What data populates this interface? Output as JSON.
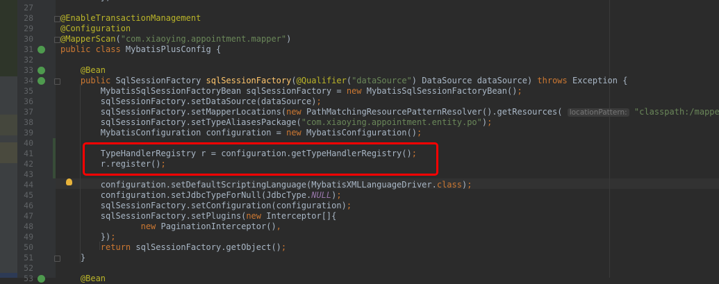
{
  "editor": {
    "lines": [
      {
        "n": "26",
        "tokens": [
          [
            "        };",
            ""
          ]
        ]
      },
      {
        "n": "27",
        "tokens": []
      },
      {
        "n": "28",
        "tokens": [
          [
            "@EnableTransactionManagement",
            "a"
          ]
        ]
      },
      {
        "n": "29",
        "tokens": [
          [
            "@Configuration",
            "a"
          ]
        ]
      },
      {
        "n": "30",
        "tokens": [
          [
            "@MapperScan",
            "a"
          ],
          [
            "(",
            ""
          ],
          [
            "\"com.xiaoying.appointment.mapper\"",
            "s"
          ],
          [
            ")",
            ""
          ]
        ]
      },
      {
        "n": "31",
        "tokens": [
          [
            "public class ",
            "k"
          ],
          [
            "MybatisPlusConfig {",
            ""
          ]
        ]
      },
      {
        "n": "32",
        "tokens": []
      },
      {
        "n": "33",
        "tokens": [
          [
            "    ",
            ""
          ],
          [
            "@Bean",
            "a"
          ]
        ]
      },
      {
        "n": "34",
        "tokens": [
          [
            "    ",
            ""
          ],
          [
            "public ",
            "k"
          ],
          [
            "SqlSessionFactory ",
            ""
          ],
          [
            "sqlSessionFactory",
            "m"
          ],
          [
            "(",
            ""
          ],
          [
            "@Qualifier",
            "a"
          ],
          [
            "(",
            ""
          ],
          [
            "\"dataSource\"",
            "s"
          ],
          [
            ") DataSource dataSource) ",
            ""
          ],
          [
            "throws ",
            "k"
          ],
          [
            "Exception {",
            ""
          ]
        ]
      },
      {
        "n": "35",
        "tokens": [
          [
            "        MybatisSqlSessionFactoryBean sqlSessionFactory = ",
            ""
          ],
          [
            "new ",
            "k"
          ],
          [
            "MybatisSqlSessionFactoryBean()",
            ""
          ],
          [
            ";",
            "p"
          ]
        ]
      },
      {
        "n": "36",
        "tokens": [
          [
            "        sqlSessionFactory.setDataSource(dataSource)",
            ""
          ],
          [
            ";",
            "p"
          ]
        ]
      },
      {
        "n": "37",
        "tokens": [
          [
            "        sqlSessionFactory.setMapperLocations(",
            ""
          ],
          [
            "new ",
            "k"
          ],
          [
            "PathMatchingResourcePatternResolver().getResources( ",
            ""
          ],
          [
            "locationPattern:",
            "hint"
          ],
          [
            " ",
            ""
          ],
          [
            "\"classpath:/mapper/*.x",
            "s"
          ]
        ]
      },
      {
        "n": "38",
        "tokens": [
          [
            "        sqlSessionFactory.setTypeAliasesPackage(",
            ""
          ],
          [
            "\"com.xiaoying.appointment.entity.po\"",
            "s"
          ],
          [
            ")",
            ""
          ],
          [
            ";",
            "p"
          ]
        ]
      },
      {
        "n": "39",
        "tokens": [
          [
            "        MybatisConfiguration configuration = ",
            ""
          ],
          [
            "new ",
            "k"
          ],
          [
            "MybatisConfiguration()",
            ""
          ],
          [
            ";",
            "p"
          ]
        ]
      },
      {
        "n": "40",
        "tokens": []
      },
      {
        "n": "41",
        "tokens": [
          [
            "        TypeHandlerRegistry r = configuration.getTypeHandlerRegistry()",
            ""
          ],
          [
            ";",
            "p"
          ]
        ]
      },
      {
        "n": "42",
        "tokens": [
          [
            "        r.register()",
            ""
          ],
          [
            ";",
            "p"
          ]
        ]
      },
      {
        "n": "43",
        "tokens": []
      },
      {
        "n": "44",
        "tokens": [
          [
            "        configuration.setDefaultScriptingLanguage(MybatisXMLLanguageDriver.",
            ""
          ],
          [
            "class",
            "k"
          ],
          [
            ")",
            ""
          ],
          [
            ";",
            "p"
          ]
        ]
      },
      {
        "n": "45",
        "tokens": [
          [
            "        configuration.setJdbcTypeForNull(JdbcType.",
            ""
          ],
          [
            "NULL",
            "c"
          ],
          [
            ")",
            ""
          ],
          [
            ";",
            "p"
          ]
        ]
      },
      {
        "n": "46",
        "tokens": [
          [
            "        sqlSessionFactory.setConfiguration(configuration)",
            ""
          ],
          [
            ";",
            "p"
          ]
        ]
      },
      {
        "n": "47",
        "tokens": [
          [
            "        sqlSessionFactory.setPlugins(",
            ""
          ],
          [
            "new ",
            "k"
          ],
          [
            "Interceptor[]{",
            ""
          ]
        ]
      },
      {
        "n": "48",
        "tokens": [
          [
            "                ",
            ""
          ],
          [
            "new ",
            "k"
          ],
          [
            "PaginationInterceptor()",
            ""
          ],
          [
            ",",
            "p"
          ]
        ]
      },
      {
        "n": "49",
        "tokens": [
          [
            "        })",
            ""
          ],
          [
            ";",
            "p"
          ]
        ]
      },
      {
        "n": "50",
        "tokens": [
          [
            "        ",
            ""
          ],
          [
            "return ",
            "k"
          ],
          [
            "sqlSessionFactory.getObject()",
            ""
          ],
          [
            ";",
            "p"
          ]
        ]
      },
      {
        "n": "51",
        "tokens": [
          [
            "    }",
            ""
          ]
        ]
      },
      {
        "n": "52",
        "tokens": []
      },
      {
        "n": "53",
        "tokens": [
          [
            "    ",
            ""
          ],
          [
            "@Bean",
            "a"
          ]
        ]
      }
    ]
  },
  "colors": {
    "highlight_box": "#ff0000",
    "background": "#2b2b2b"
  }
}
